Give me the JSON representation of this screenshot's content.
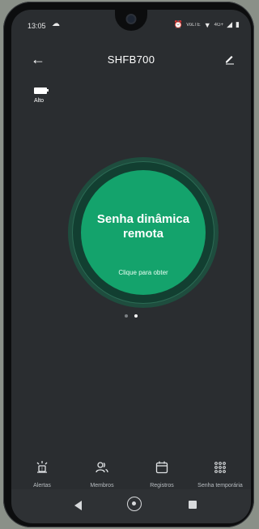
{
  "status_bar": {
    "time": "13:05",
    "cloud_icon": "cloud-icon",
    "alarm_icon": "alarm-icon",
    "network_text": "VoLTE",
    "signal_text": "4G+",
    "icons": [
      "alarm-icon",
      "volte-icon",
      "wifi-icon",
      "signal-icon",
      "battery-icon"
    ]
  },
  "header": {
    "title": "SHFB700",
    "back_icon": "back-arrow-icon",
    "edit_icon": "edit-icon"
  },
  "battery": {
    "label": "Alto",
    "icon": "battery-icon"
  },
  "main": {
    "title_line1": "Senha dinâmica",
    "title_line2": "remota",
    "subtitle": "Clique para obter",
    "accent_color": "#14a36c"
  },
  "pager": {
    "total": 2,
    "active_index": 1
  },
  "bottom_nav": {
    "items": [
      {
        "label": "Alertas",
        "icon": "alarm-siren-icon"
      },
      {
        "label": "Membros",
        "icon": "members-icon"
      },
      {
        "label": "Registros",
        "icon": "calendar-icon"
      },
      {
        "label": "Senha temporária",
        "icon": "keypad-icon"
      }
    ]
  },
  "system_nav": {
    "back": "nav-back-icon",
    "home": "nav-home-icon",
    "recents": "nav-recents-icon"
  }
}
